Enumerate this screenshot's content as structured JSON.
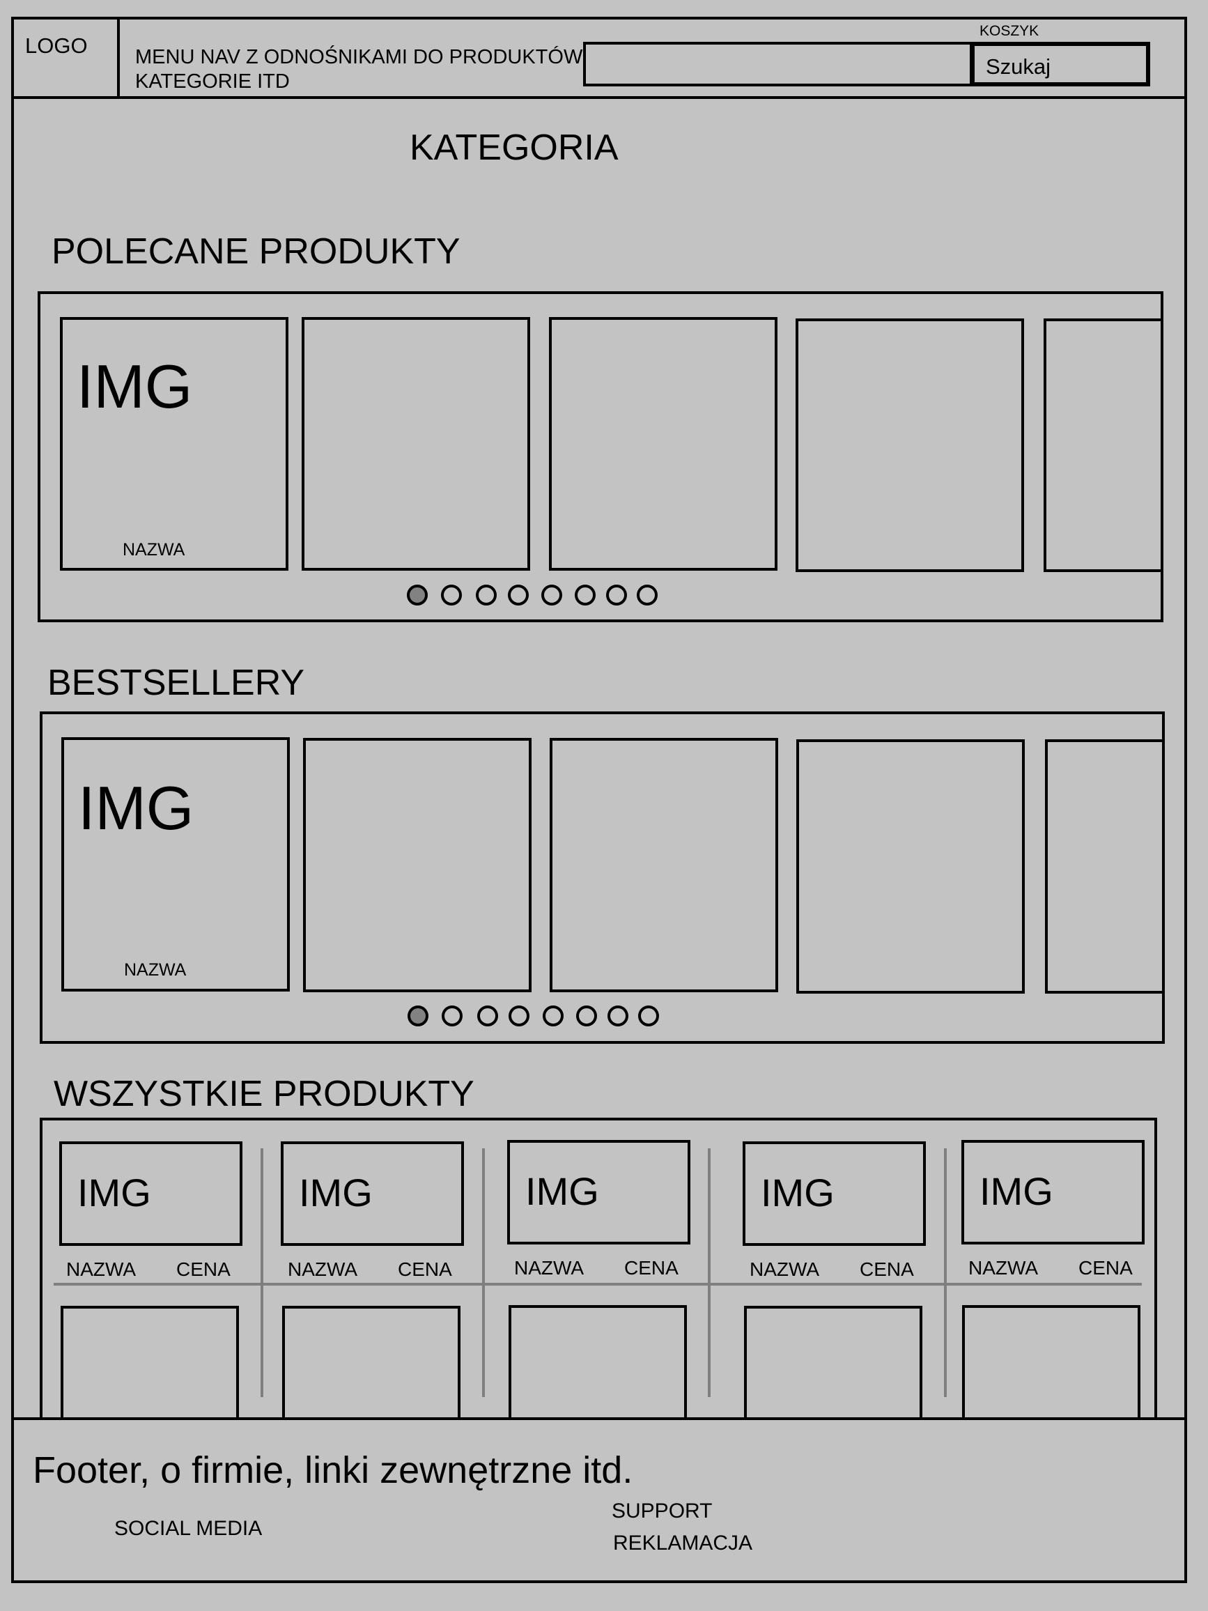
{
  "header": {
    "logo": "LOGO",
    "nav_line1": "MENU NAV Z ODNOŚNIKAMI DO PRODUKTÓW",
    "nav_line2": "KATEGORIE ITD",
    "cart_label": "KOSZYK",
    "search_value": "",
    "search_button": "Szukaj"
  },
  "main": {
    "category_title": "KATEGORIA",
    "featured": {
      "title": "POLECANE PRODUKTY",
      "card_img": "IMG",
      "card_name": "NAZWA",
      "active_dot": 1,
      "dot_count": 8
    },
    "bestsellers": {
      "title": "BESTSELLERY",
      "card_img": "IMG",
      "card_name": "NAZWA",
      "active_dot": 1,
      "dot_count": 8
    },
    "all_products": {
      "title": "WSZYSTKIE PRODUKTY",
      "items": [
        {
          "img": "IMG",
          "name": "NAZWA",
          "price": "CENA"
        },
        {
          "img": "IMG",
          "name": "NAZWA",
          "price": "CENA"
        },
        {
          "img": "IMG",
          "name": "NAZWA",
          "price": "CENA"
        },
        {
          "img": "IMG",
          "name": "NAZWA",
          "price": "CENA"
        },
        {
          "img": "IMG",
          "name": "NAZWA",
          "price": "CENA"
        }
      ]
    }
  },
  "footer": {
    "text": "Footer, o firmie, linki zewnętrzne itd.",
    "social": "SOCIAL MEDIA",
    "support": "SUPPORT",
    "complaints": "REKLAMACJA"
  },
  "colors": {
    "background": "#c3c3c3",
    "border": "#000000",
    "separator": "#7f7f7f",
    "active_dot": "#828282"
  }
}
